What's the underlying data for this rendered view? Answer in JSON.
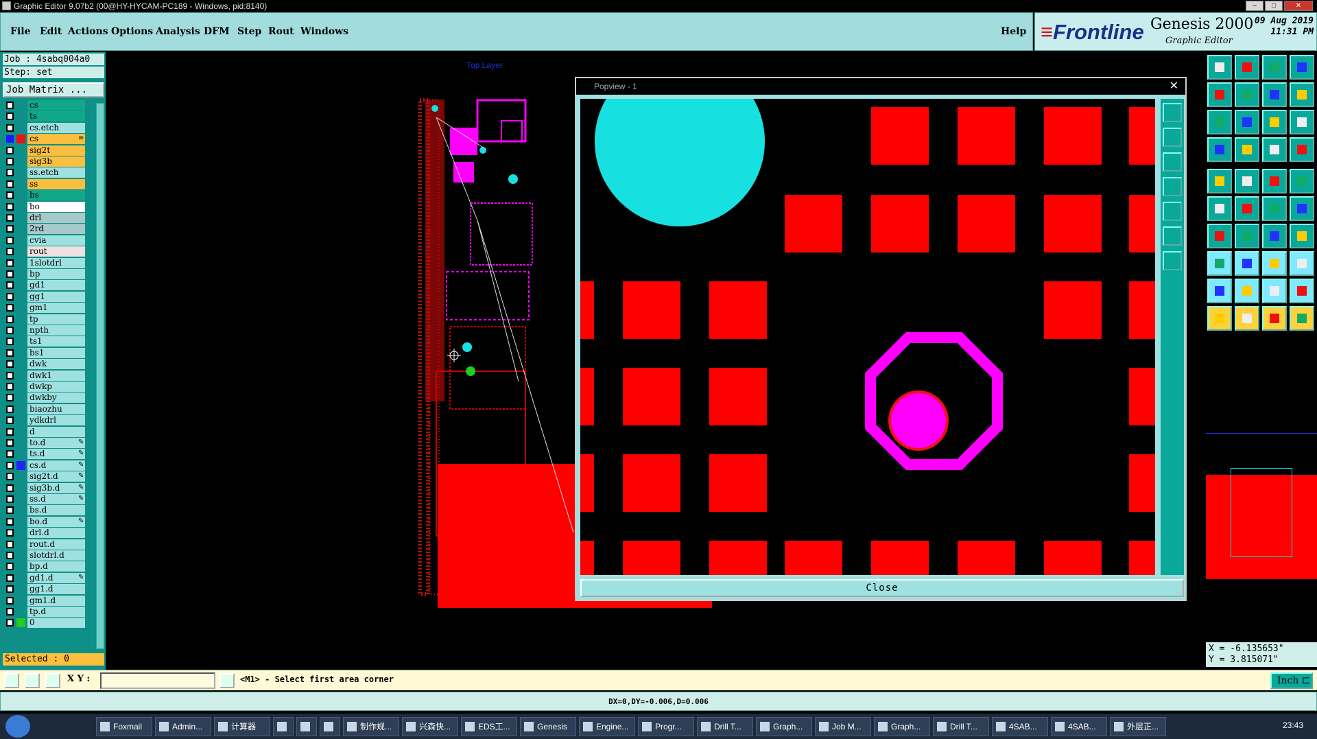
{
  "window": {
    "title": "Graphic Editor 9.07b2 (00@HY-HYCAM-PC189 - Windows, pid:8140)"
  },
  "menu": [
    "File",
    "Edit",
    "Actions",
    "Options",
    "Analysis",
    "DFM",
    "Step",
    "Rout",
    "Windows"
  ],
  "help": "Help",
  "brand": {
    "company": "Frontline",
    "product": "Genesis 2000",
    "sub": "Graphic Editor",
    "date": "09 Aug 2019",
    "time": "11:31 PM"
  },
  "job": {
    "label": "Job : 4sabq004a0",
    "step": "Step: set",
    "matrix": "Job Matrix ..."
  },
  "layers": [
    {
      "name": "cs",
      "c": "g",
      "sw": ""
    },
    {
      "name": "ts",
      "c": "g",
      "sw": ""
    },
    {
      "name": "cs.etch",
      "c": "",
      "sw": ""
    },
    {
      "name": "cs",
      "c": "y",
      "sw": "#e11",
      "on": true,
      "pen": "≡"
    },
    {
      "name": "sig2t",
      "c": "y",
      "sw": ""
    },
    {
      "name": "sig3b",
      "c": "y",
      "sw": ""
    },
    {
      "name": "ss.etch",
      "c": "",
      "sw": ""
    },
    {
      "name": "ss",
      "c": "y",
      "sw": ""
    },
    {
      "name": "bs",
      "c": "g",
      "sw": ""
    },
    {
      "name": "bo",
      "c": "w",
      "sw": ""
    },
    {
      "name": "drl",
      "c": "gr",
      "sw": ""
    },
    {
      "name": "2rd",
      "c": "gr",
      "sw": ""
    },
    {
      "name": "cvia",
      "c": "",
      "sw": ""
    },
    {
      "name": "rout",
      "c": "pk",
      "sw": ""
    },
    {
      "name": "1slotdrl",
      "c": "",
      "sw": ""
    },
    {
      "name": "bp",
      "c": "",
      "sw": ""
    },
    {
      "name": "gd1",
      "c": "",
      "sw": ""
    },
    {
      "name": "gg1",
      "c": "",
      "sw": ""
    },
    {
      "name": "gm1",
      "c": "",
      "sw": ""
    },
    {
      "name": "tp",
      "c": "",
      "sw": ""
    },
    {
      "name": "npth",
      "c": "",
      "sw": ""
    },
    {
      "name": "ts1",
      "c": "",
      "sw": ""
    },
    {
      "name": "bs1",
      "c": "",
      "sw": ""
    },
    {
      "name": "dwk",
      "c": "",
      "sw": ""
    },
    {
      "name": "dwk1",
      "c": "",
      "sw": ""
    },
    {
      "name": "dwkp",
      "c": "",
      "sw": ""
    },
    {
      "name": "dwkby",
      "c": "",
      "sw": ""
    },
    {
      "name": "biaozhu",
      "c": "",
      "sw": ""
    },
    {
      "name": "ydkdrl",
      "c": "",
      "sw": ""
    },
    {
      "name": "d",
      "c": "",
      "sw": ""
    },
    {
      "name": "to.d",
      "c": "",
      "sw": "",
      "pen": "✎"
    },
    {
      "name": "ts.d",
      "c": "",
      "sw": "",
      "pen": "✎"
    },
    {
      "name": "cs.d",
      "c": "",
      "sw": "#22f",
      "pen": "✎"
    },
    {
      "name": "sig2t.d",
      "c": "",
      "sw": "",
      "pen": "✎"
    },
    {
      "name": "sig3b.d",
      "c": "",
      "sw": "",
      "pen": "✎"
    },
    {
      "name": "ss.d",
      "c": "",
      "sw": "",
      "pen": "✎"
    },
    {
      "name": "bs.d",
      "c": "",
      "sw": ""
    },
    {
      "name": "bo.d",
      "c": "",
      "sw": "",
      "pen": "✎"
    },
    {
      "name": "drl.d",
      "c": "",
      "sw": ""
    },
    {
      "name": "rout.d",
      "c": "",
      "sw": ""
    },
    {
      "name": "slotdrl.d",
      "c": "",
      "sw": ""
    },
    {
      "name": "bp.d",
      "c": "",
      "sw": ""
    },
    {
      "name": "gd1.d",
      "c": "",
      "sw": "",
      "pen": "✎"
    },
    {
      "name": "gg1.d",
      "c": "",
      "sw": ""
    },
    {
      "name": "gm1.d",
      "c": "",
      "sw": ""
    },
    {
      "name": "tp.d",
      "c": "",
      "sw": ""
    },
    {
      "name": "0",
      "c": "",
      "sw": "#2c2"
    }
  ],
  "selected": "Selected : 0",
  "canvas": {
    "layer_label": "Top Layer"
  },
  "popview": {
    "title": "Popview - 1",
    "close": "Close"
  },
  "coords": {
    "x": "X = -6.135653\"",
    "y": "Y = 3.815071\""
  },
  "status": {
    "xy_label": "X Y :",
    "prompt": "<M1> - Select first area corner",
    "unit": "Inch",
    "dx": "DX=0,DY=-0.006,D=0.006"
  },
  "taskbar": {
    "items": [
      "Foxmail",
      "Admin...",
      "计算器",
      "",
      "",
      "",
      "制作规...",
      "兴森快...",
      "EDS工...",
      "Genesis",
      "Engine...",
      "Progr...",
      "Drill T...",
      "Graph...",
      "Job M...",
      "Graph...",
      "Drill T...",
      "4SAB...",
      "4SAB...",
      "外层正..."
    ],
    "clock": "23:43"
  }
}
